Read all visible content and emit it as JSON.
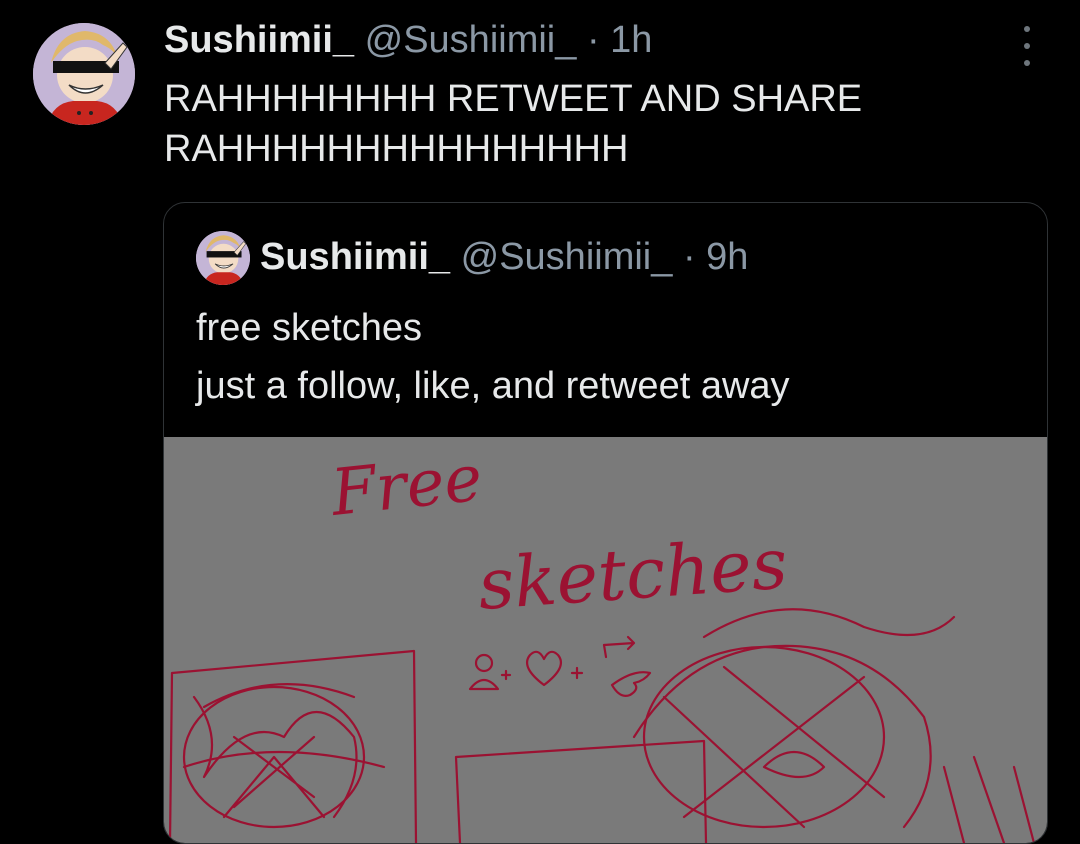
{
  "tweet": {
    "display_name": "Sushiimii_",
    "handle": "@Sushiimii_",
    "separator": "·",
    "time": "1h",
    "text_line1": "RAHHHHHHHH RETWEET AND SHARE",
    "text_line2": "RAHHHHHHHHHHHHHHH",
    "more_icon": "more-vertical-icon"
  },
  "quoted_tweet": {
    "display_name": "Sushiimii_",
    "handle": "@Sushiimii_",
    "separator": "·",
    "time": "9h",
    "text_line1": "free sketches",
    "text_line2": "just a follow, like, and retweet away",
    "image": {
      "title_line1": "Free",
      "title_line2": "sketches",
      "icons": [
        "follow-icon",
        "heart-icon",
        "retweet-icon",
        "bird-icon"
      ],
      "background": "#7a7a7a",
      "ink": "#9b1232"
    }
  },
  "colors": {
    "background": "#000000",
    "primary_text": "#e7e9ea",
    "secondary_text": "#8b98a5",
    "border": "#2f3336"
  }
}
